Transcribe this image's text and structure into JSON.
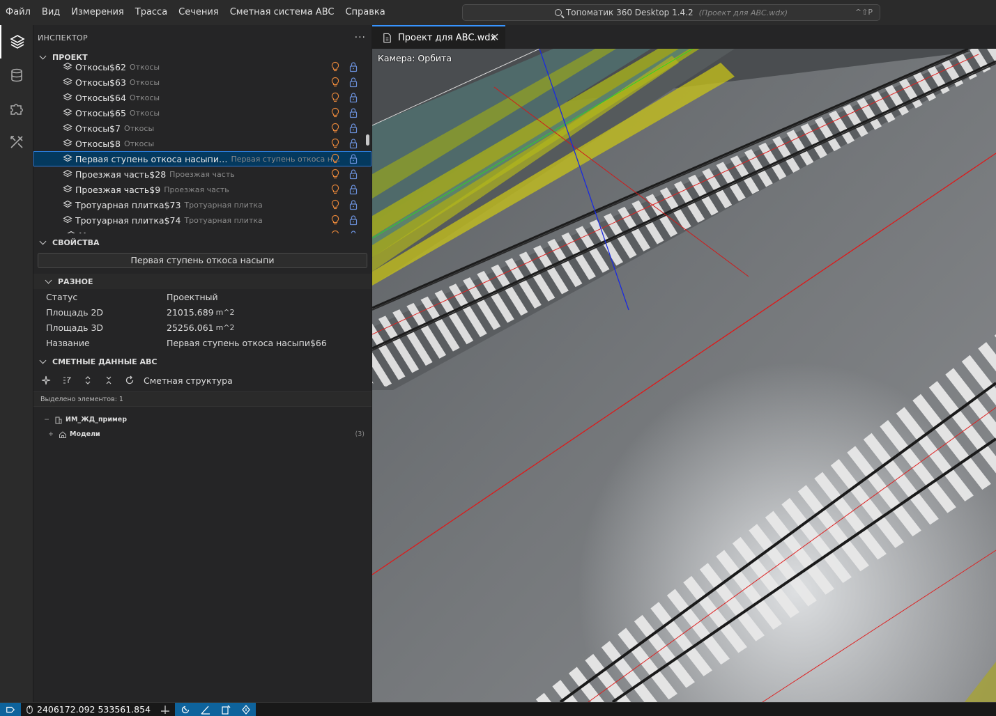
{
  "menubar": {
    "items": [
      "Файл",
      "Вид",
      "Измерения",
      "Трасса",
      "Сечения",
      "Сметная система ABC",
      "Справка"
    ]
  },
  "command_center": {
    "title": "Топоматик 360 Desktop 1.4.2",
    "project": "(Проект для ABC.wdx)",
    "shortcut": "^⇧P"
  },
  "activity_bar": {
    "icons": [
      "layers-icon",
      "database-icon",
      "puzzle-icon",
      "tools-icon"
    ]
  },
  "inspector": {
    "title": "ИНСПЕКТОР",
    "more": "···",
    "project_section": "ПРОЕКТ",
    "tree": [
      {
        "name": "Откосы$62",
        "desc": "Откосы"
      },
      {
        "name": "Откосы$63",
        "desc": "Откосы"
      },
      {
        "name": "Откосы$64",
        "desc": "Откосы"
      },
      {
        "name": "Откосы$65",
        "desc": "Откосы"
      },
      {
        "name": "Откосы$7",
        "desc": "Откосы"
      },
      {
        "name": "Откосы$8",
        "desc": "Откосы"
      },
      {
        "name": "Первая ступень откоса насыпи…",
        "desc": "Первая ступень откоса нас…",
        "selected": true
      },
      {
        "name": "Проезжая часть$28",
        "desc": "Проезжая часть"
      },
      {
        "name": "Проезжая часть$9",
        "desc": "Проезжая часть"
      },
      {
        "name": "Тротуарная плитка$73",
        "desc": "Тротуарная плитка"
      },
      {
        "name": "Тротуарная плитка$74",
        "desc": "Тротуарная плитка"
      },
      {
        "name": "Модели",
        "desc": ""
      }
    ]
  },
  "properties": {
    "section": "СВОЙСТВА",
    "selected_name": "Первая ступень откоса насыпи",
    "group": "РАЗНОЕ",
    "rows": [
      {
        "key": "Статус",
        "value": "Проектный",
        "unit": ""
      },
      {
        "key": "Площадь 2D",
        "value": "21015.689",
        "unit": "m^2"
      },
      {
        "key": "Площадь 3D",
        "value": "25256.061",
        "unit": "m^2"
      },
      {
        "key": "Название",
        "value": "Первая ступень откоса насыпи$66",
        "unit": ""
      }
    ]
  },
  "estimate": {
    "section": "СМЕТНЫЕ ДАННЫЕ ABC",
    "toolbar_label": "Сметная структура",
    "selected_count": "Выделено элементов: 1",
    "tree": [
      {
        "toggle": "−",
        "name": "ИМ_ЖД_пример",
        "count": ""
      },
      {
        "toggle": "+",
        "name": "Модели",
        "count": "(3)"
      }
    ]
  },
  "editor": {
    "tab_label": "Проект для ABC.wdx",
    "camera_label": "Камера: Орбита"
  },
  "statusbar": {
    "coords": "2406172.092 533561.854"
  },
  "colors": {
    "accent": "#0e639c",
    "selection": "#04395e",
    "bulb": "#e8873a",
    "lock": "#6a8fd8"
  }
}
